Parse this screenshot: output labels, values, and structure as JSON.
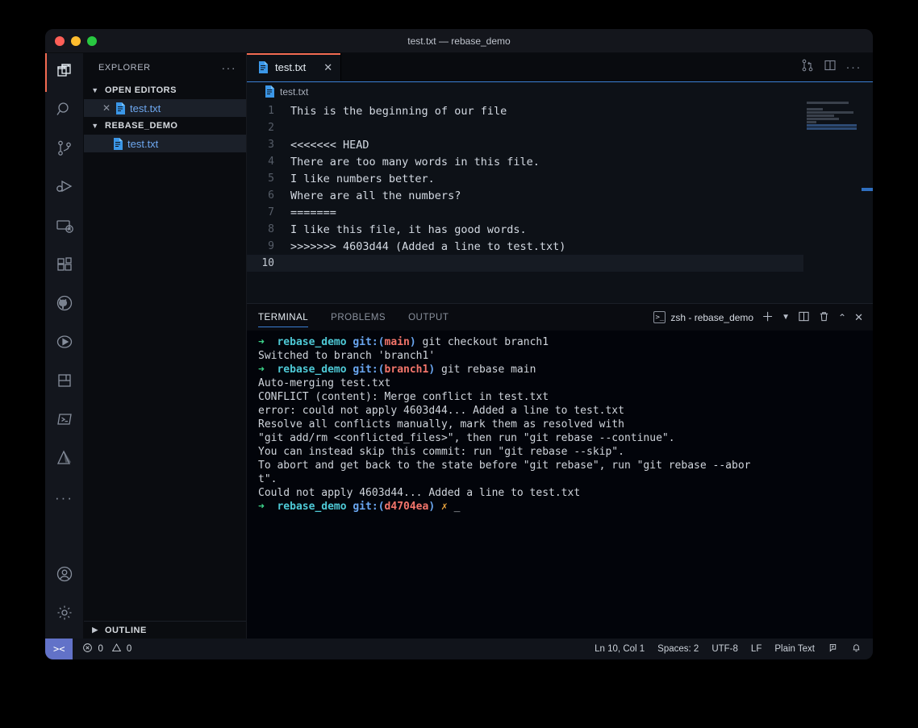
{
  "window": {
    "title": "test.txt — rebase_demo",
    "traffic_lights": [
      "close",
      "minimize",
      "maximize"
    ]
  },
  "activity_bar": {
    "items": [
      {
        "name": "explorer",
        "icon": "files-icon",
        "active": true
      },
      {
        "name": "search",
        "icon": "search-icon",
        "active": false
      },
      {
        "name": "source-control",
        "icon": "source-control-icon",
        "active": false
      },
      {
        "name": "run-and-debug",
        "icon": "run-debug-icon",
        "active": false
      },
      {
        "name": "remote-explorer",
        "icon": "remote-explorer-icon",
        "active": false
      },
      {
        "name": "extensions",
        "icon": "extensions-icon",
        "active": false
      },
      {
        "name": "github",
        "icon": "github-icon",
        "active": false
      },
      {
        "name": "test-runner",
        "icon": "play-circle-icon",
        "active": false
      },
      {
        "name": "notebook",
        "icon": "book-icon",
        "active": false
      },
      {
        "name": "terminal-tools",
        "icon": "terminal-icon",
        "active": false
      },
      {
        "name": "azure",
        "icon": "azure-icon",
        "active": false
      },
      {
        "name": "more-views",
        "icon": "ellipsis-icon",
        "active": false
      }
    ],
    "bottom_items": [
      {
        "name": "accounts",
        "icon": "account-icon"
      },
      {
        "name": "manage-settings",
        "icon": "gear-icon"
      }
    ]
  },
  "sidebar": {
    "title": "EXPLORER",
    "more_actions": "···",
    "sections": [
      {
        "label": "OPEN EDITORS",
        "expanded": true,
        "items": [
          {
            "label": "test.txt",
            "icon": "text-file-icon",
            "has_close": true
          }
        ]
      },
      {
        "label": "REBASE_DEMO",
        "expanded": true,
        "items": [
          {
            "label": "test.txt",
            "icon": "text-file-icon",
            "has_close": false
          }
        ]
      }
    ],
    "outline": {
      "label": "OUTLINE",
      "expanded": false
    }
  },
  "editor": {
    "tabs": [
      {
        "label": "test.txt",
        "icon": "text-file-icon",
        "active": true,
        "close": "✕"
      }
    ],
    "actions": [
      "open-changes-icon",
      "split-editor-icon",
      "more-actions-icon"
    ],
    "breadcrumb": "test.txt",
    "lines": [
      {
        "num": "1",
        "text": "This is the beginning of our file"
      },
      {
        "num": "2",
        "text": ""
      },
      {
        "num": "3",
        "text": "<<<<<<< HEAD"
      },
      {
        "num": "4",
        "text": "There are too many words in this file."
      },
      {
        "num": "5",
        "text": "I like numbers better."
      },
      {
        "num": "6",
        "text": "Where are all the numbers?"
      },
      {
        "num": "7",
        "text": "======="
      },
      {
        "num": "8",
        "text": "I like this file, it has good words."
      },
      {
        "num": "9",
        "text": ">>>>>>> 4603d44 (Added a line to test.txt)"
      },
      {
        "num": "10",
        "text": "",
        "current": true
      }
    ]
  },
  "panel": {
    "tabs": [
      {
        "label": "TERMINAL",
        "active": true
      },
      {
        "label": "PROBLEMS",
        "active": false
      },
      {
        "label": "OUTPUT",
        "active": false
      }
    ],
    "terminal_name": "zsh - rebase_demo",
    "actions": [
      "new-terminal-icon",
      "chevron-down-icon",
      "split-terminal-icon",
      "kill-terminal-icon",
      "maximize-panel-icon",
      "close-panel-icon"
    ],
    "terminal_lines": [
      {
        "type": "prompt",
        "dir": "rebase_demo",
        "branch": "main",
        "command": " git checkout branch1"
      },
      {
        "type": "plain",
        "text": "Switched to branch 'branch1'"
      },
      {
        "type": "prompt",
        "dir": "rebase_demo",
        "branch": "branch1",
        "command": " git rebase main"
      },
      {
        "type": "plain",
        "text": "Auto-merging test.txt"
      },
      {
        "type": "plain",
        "text": "CONFLICT (content): Merge conflict in test.txt"
      },
      {
        "type": "plain",
        "text": "error: could not apply 4603d44... Added a line to test.txt"
      },
      {
        "type": "plain",
        "text": "Resolve all conflicts manually, mark them as resolved with"
      },
      {
        "type": "plain",
        "text": "\"git add/rm <conflicted_files>\", then run \"git rebase --continue\"."
      },
      {
        "type": "plain",
        "text": "You can instead skip this commit: run \"git rebase --skip\"."
      },
      {
        "type": "plain",
        "text": "To abort and get back to the state before \"git rebase\", run \"git rebase --abor"
      },
      {
        "type": "plain",
        "text": "t\"."
      },
      {
        "type": "plain",
        "text": "Could not apply 4603d44... Added a line to test.txt"
      },
      {
        "type": "prompt_end",
        "dir": "rebase_demo",
        "branch": "d4704ea",
        "mark": "✗",
        "cursor": "_"
      }
    ]
  },
  "status_bar": {
    "remote_icon": "remote-window-icon",
    "errors": "0",
    "warnings": "0",
    "position": "Ln 10, Col 1",
    "indentation": "Spaces: 2",
    "encoding": "UTF-8",
    "eol": "LF",
    "language": "Plain Text",
    "feedback_icon": "feedback-icon",
    "bell_icon": "bell-icon"
  },
  "colors": {
    "accent_blue": "#3b7fd4",
    "tab_active_border": "#f26b52",
    "remote_bg": "#6272c8",
    "file_blue": "#6ea8f0",
    "term_green": "#3dd68c",
    "term_cyan": "#4ec9d6",
    "term_branch": "#f4756b",
    "term_mark": "#e8a33d"
  }
}
